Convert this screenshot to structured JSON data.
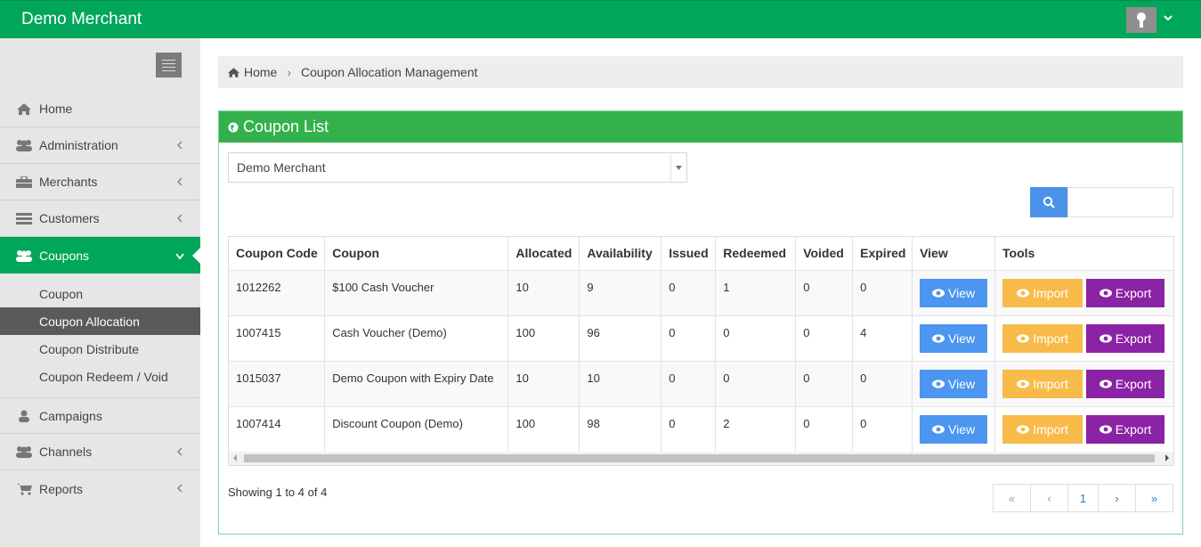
{
  "header": {
    "brand": "Demo Merchant",
    "user_icon": "user-icon",
    "caret_icon": "chevron-down-icon"
  },
  "sidebar": {
    "toggle_icon": "hamburger-icon",
    "items": [
      {
        "label": "Home",
        "icon": "home-icon",
        "has_chevron": false
      },
      {
        "label": "Administration",
        "icon": "users-icon",
        "has_chevron": true
      },
      {
        "label": "Merchants",
        "icon": "briefcase-icon",
        "has_chevron": true
      },
      {
        "label": "Customers",
        "icon": "list-icon",
        "has_chevron": true
      },
      {
        "label": "Coupons",
        "icon": "users-icon",
        "has_chevron": true,
        "active": true
      },
      {
        "label": "Campaigns",
        "icon": "user-icon",
        "has_chevron": false
      },
      {
        "label": "Channels",
        "icon": "users-icon",
        "has_chevron": true
      },
      {
        "label": "Reports",
        "icon": "cart-icon",
        "has_chevron": true
      }
    ],
    "sub_items": [
      {
        "label": "Coupon"
      },
      {
        "label": "Coupon Allocation",
        "selected": true
      },
      {
        "label": "Coupon Distribute"
      },
      {
        "label": "Coupon Redeem / Void"
      }
    ]
  },
  "breadcrumb": {
    "home": "Home",
    "current": "Coupon Allocation Management"
  },
  "panel": {
    "title": "Coupon List",
    "merchant_select": "Demo Merchant",
    "search_placeholder": "",
    "columns": [
      "Coupon Code",
      "Coupon",
      "Allocated",
      "Availability",
      "Issued",
      "Redeemed",
      "Voided",
      "Expired",
      "View",
      "Tools"
    ],
    "rows": [
      {
        "code": "1012262",
        "coupon": "$100 Cash Voucher",
        "allocated": "10",
        "availability": "9",
        "issued": "0",
        "redeemed": "1",
        "voided": "0",
        "expired": "0"
      },
      {
        "code": "1007415",
        "coupon": "Cash Voucher (Demo)",
        "allocated": "100",
        "availability": "96",
        "issued": "0",
        "redeemed": "0",
        "voided": "0",
        "expired": "4"
      },
      {
        "code": "1015037",
        "coupon": "Demo Coupon with Expiry Date",
        "allocated": "10",
        "availability": "10",
        "issued": "0",
        "redeemed": "0",
        "voided": "0",
        "expired": "0"
      },
      {
        "code": "1007414",
        "coupon": "Discount Coupon (Demo)",
        "allocated": "100",
        "availability": "98",
        "issued": "0",
        "redeemed": "2",
        "voided": "0",
        "expired": "0"
      }
    ],
    "buttons": {
      "view": "View",
      "import": "Import",
      "export": "Export"
    },
    "showing": "Showing 1 to 4 of 4",
    "pager": {
      "first": "«",
      "prev": "‹",
      "page": "1",
      "next": "›",
      "last": "»"
    }
  },
  "colors": {
    "brand_green": "#00a65a",
    "panel_green": "#34b14c",
    "view_blue": "#4c95f0",
    "import_orange": "#f8bb4a",
    "export_purple": "#8a23a3"
  }
}
